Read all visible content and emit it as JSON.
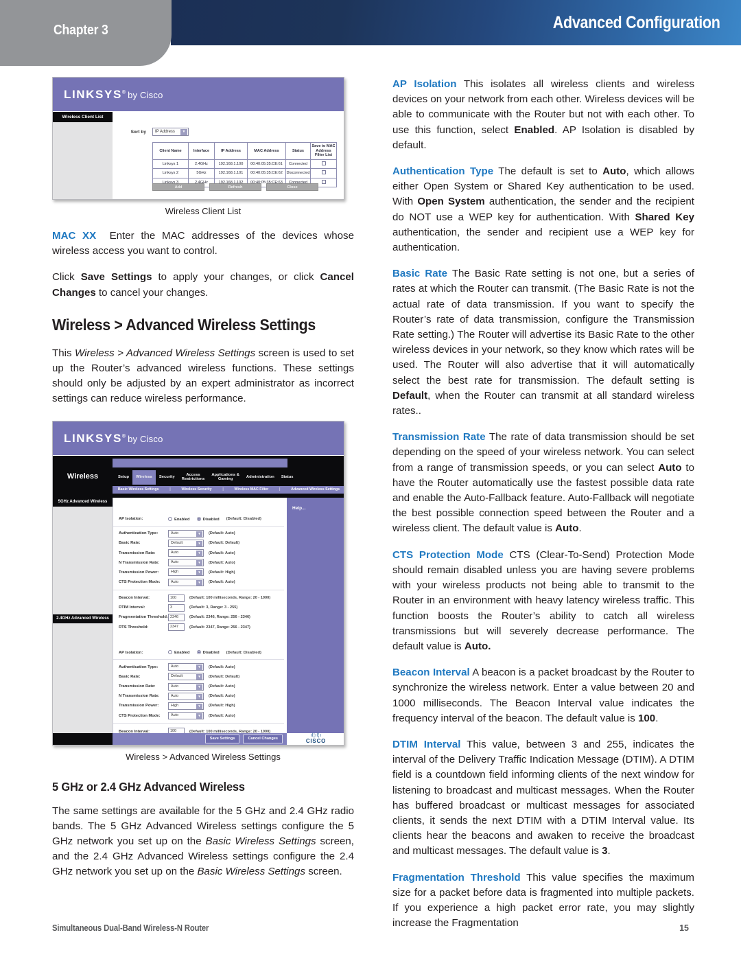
{
  "header": {
    "chapter": "Chapter 3",
    "title": "Advanced Configuration",
    "accent_dark": "#1b2f55",
    "accent_light": "#3c87c8",
    "tab_gray": "#939598"
  },
  "footer": {
    "product": "Simultaneous Dual-Band Wireless-N Router",
    "page_number": "15"
  },
  "figures": {
    "client_list": {
      "caption": "Wireless Client List",
      "brand": "LINKSYS",
      "brand_reg": "®",
      "brand_by": "by Cisco",
      "sidebar_tab": "Wireless Client List",
      "sort_label": "Sort by",
      "sort_value": "IP Address",
      "columns": [
        "Client Name",
        "Interface",
        "IP Address",
        "MAC Address",
        "Status",
        "Save to MAC Address Filter List"
      ],
      "rows": [
        {
          "client": "Linksys 1",
          "interface": "2.4GHz",
          "ip": "192.168.1.100",
          "mac": "00:40:05:35:CE:61",
          "status": "Connected"
        },
        {
          "client": "Linksys 2",
          "interface": "5GHz",
          "ip": "192.168.1.101",
          "mac": "00:40:05:35:CE:62",
          "status": "Disconnected"
        },
        {
          "client": "Linksys 3",
          "interface": "2.4GHz",
          "ip": "192.168.1.102",
          "mac": "00:40:05:35:CE:63",
          "status": "Connected"
        }
      ],
      "buttons": [
        "Add",
        "Refresh",
        "Close"
      ]
    },
    "advanced_wireless": {
      "caption": "Wireless > Advanced Wireless Settings",
      "brand": "LINKSYS",
      "brand_reg": "®",
      "brand_by": "by Cisco",
      "section_name": "Wireless",
      "tabs": [
        "Setup",
        "Wireless",
        "Security",
        "Access\nRestrictions",
        "Applications &\nGaming",
        "Administration",
        "Status"
      ],
      "active_tab": "Wireless",
      "subtabs": [
        "Basic Wireless Settings",
        "Wireless Security",
        "Wireless MAC Filter",
        "Advanced Wireless Settings"
      ],
      "help_label": "Help...",
      "band_5ghz_tab": "5GHz Advanced Wireless",
      "band_24ghz_tab": "2.4GHz Advanced Wireless",
      "ap_isolation": {
        "label": "AP Isolation:",
        "enabled": "Enabled",
        "disabled": "Disabled",
        "default_note": "(Default: Disabled)"
      },
      "select_rows": [
        {
          "label": "Authentication Type:",
          "value": "Auto",
          "note": "(Default: Auto)"
        },
        {
          "label": "Basic Rate:",
          "value": "Default",
          "note": "(Default: Default)"
        },
        {
          "label": "Transmission Rate:",
          "value": "Auto",
          "note": "(Default: Auto)"
        },
        {
          "label": "N Transmission Rate:",
          "value": "Auto",
          "note": "(Default: Auto)"
        },
        {
          "label": "Transmission Power:",
          "value": "High",
          "note": "(Default: High)"
        },
        {
          "label": "CTS Protection Mode:",
          "value": "Auto",
          "note": "(Default: Auto)"
        }
      ],
      "input_rows": [
        {
          "label": "Beacon Interval:",
          "value": "100",
          "note": "(Default: 100 milliseconds, Range: 20 - 1000)"
        },
        {
          "label": "DTIM Interval:",
          "value": "3",
          "note": "(Default: 3, Range: 3 - 255)"
        },
        {
          "label": "Fragmentation Threshold:",
          "value": "2346",
          "note": "(Default: 2346, Range: 256 - 2346)"
        },
        {
          "label": "RTS Threshold:",
          "value": "2347",
          "note": "(Default: 2347, Range: 256 - 2347)"
        }
      ],
      "buttons": [
        "Save Settings",
        "Cancel Changes"
      ],
      "cisco_word": "CISCO"
    }
  },
  "left_column": {
    "mac_xx": {
      "term": "MAC XX",
      "text": "Enter the MAC addresses of the devices whose wireless access you want to control."
    },
    "save_cancel": {
      "p1": "Click ",
      "b1": "Save Settings",
      "p2": " to apply your changes, or click ",
      "b2": "Cancel Changes",
      "p3": " to cancel your changes."
    },
    "section_title": "Wireless > Advanced Wireless Settings",
    "intro": {
      "p1": "This ",
      "i1": "Wireless > Advanced Wireless Settings",
      "p2": " screen is used to set up the Router’s advanced wireless functions. These settings should only be adjusted by an expert administrator as incorrect settings can reduce wireless performance."
    },
    "sub_title": "5 GHz or 2.4 GHz Advanced Wireless",
    "bands": {
      "p1": "The same settings are available for the 5 GHz and 2.4 GHz radio bands. The 5 GHz Advanced Wireless settings configure the 5 GHz network you set up on the ",
      "i1": "Basic Wireless Settings",
      "p2": " screen, and the 2.4 GHz Advanced Wireless settings configure the 2.4 GHz network you set up on the ",
      "i2": "Basic Wireless Settings",
      "p3": " screen."
    }
  },
  "right_column": {
    "ap_isolation": {
      "term": "AP Isolation",
      "p1": "  This isolates all wireless clients and wireless devices on your network from each other. Wireless devices will be able to communicate with the Router but not with each other. To use this function, select ",
      "b1": "Enabled",
      "p2": ". AP Isolation is disabled by default."
    },
    "authentication_type": {
      "term": "Authentication Type",
      "p1": "  The default is set to ",
      "b1": "Auto",
      "p2": ", which allows either Open System or Shared Key authentication to be used. With ",
      "b2": "Open System",
      "p3": " authentication, the sender and the recipient do NOT use a WEP key for authentication. With ",
      "b3": "Shared Key",
      "p4": " authentication, the sender and recipient use a WEP key for authentication."
    },
    "basic_rate": {
      "term": "Basic Rate",
      "p1": "  The Basic Rate setting is not one, but a series of rates at which the Router can transmit. (The Basic Rate is not the actual rate of data transmission. If you want to specify the Router’s rate of data transmission, configure the Transmission Rate setting.) The Router will advertise its Basic Rate to the other wireless devices in your network, so they know which rates will be used. The Router will also advertise that it will automatically select the best rate for transmission. The default setting is ",
      "b1": "Default",
      "p2": ", when the Router can transmit at all standard wireless rates.."
    },
    "transmission_rate": {
      "term": "Transmission Rate",
      "p1": "  The rate of data transmission should be set depending on the speed of your wireless network. You can select from a range of transmission speeds, or you can select ",
      "b1": "Auto",
      "p2": " to have the Router automatically use the fastest possible data rate and enable the Auto-Fallback feature. Auto-Fallback will negotiate the best possible connection speed between the Router and a wireless client. The default value is ",
      "b2": "Auto",
      "p3": "."
    },
    "cts_protection": {
      "term": "CTS Protection Mode",
      "p1": " CTS (Clear-To-Send) Protection Mode should remain disabled unless you are having severe problems with your wireless products not being able to transmit to the Router in an environment with heavy latency wireless traffic. This function boosts the Router’s ability to catch all wireless transmissions but will severely decrease performance. The default value is ",
      "b1": "Auto."
    },
    "beacon_interval": {
      "term": "Beacon Interval",
      "p1": "  A beacon is a packet broadcast by the Router to synchronize the wireless network. Enter a value between 20 and 1000 milliseconds. The Beacon Interval value indicates the frequency interval of the beacon. The default value is ",
      "b1": "100",
      "p2": "."
    },
    "dtim_interval": {
      "term": "DTIM Interval",
      "p1": "  This value, between 3 and 255, indicates the interval of the Delivery Traffic Indication Message (DTIM). A DTIM field is a countdown field informing clients of the next window for listening to broadcast and multicast messages. When the Router has buffered broadcast or multicast messages for associated clients, it sends the next DTIM with a DTIM Interval value. Its clients hear the beacons and awaken to receive the broadcast and multicast messages. The default value is ",
      "b1": "3",
      "p2": "."
    },
    "fragmentation_threshold": {
      "term": "Fragmentation Threshold",
      "p1": " This value specifies the maximum size for a packet before data is fragmented into multiple packets. If you experience a high packet error rate, you may slightly increase the Fragmentation"
    }
  }
}
